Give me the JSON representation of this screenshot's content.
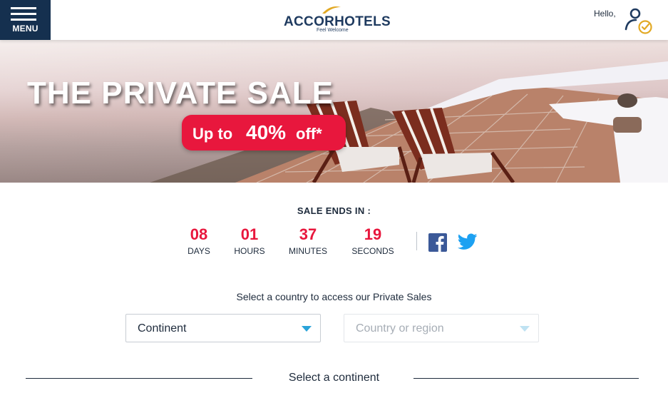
{
  "header": {
    "menu_label": "MENU",
    "logo_brand": "ACCORHOTELS",
    "logo_tagline": "Feel Welcome",
    "greeting": "Hello,"
  },
  "hero": {
    "title": "THE PRIVATE SALE",
    "badge_prefix": "Up to",
    "badge_value": "40%",
    "badge_suffix": "off*"
  },
  "countdown": {
    "heading": "SALE ENDS IN :",
    "days": {
      "value": "08",
      "label": "DAYS"
    },
    "hours": {
      "value": "01",
      "label": "HOURS"
    },
    "minutes": {
      "value": "37",
      "label": "MINUTES"
    },
    "seconds": {
      "value": "19",
      "label": "SECONDS"
    }
  },
  "social": {
    "facebook_icon": "facebook-icon",
    "twitter_icon": "twitter-icon"
  },
  "selector": {
    "heading": "Select a country to access our Private Sales",
    "continent_value": "Continent",
    "country_value": "Country or region",
    "section_title": "Select a continent"
  },
  "colors": {
    "accent": "#e8173d",
    "navy": "#15304f",
    "link_blue": "#2aa3d9",
    "gold": "#e2a924"
  }
}
